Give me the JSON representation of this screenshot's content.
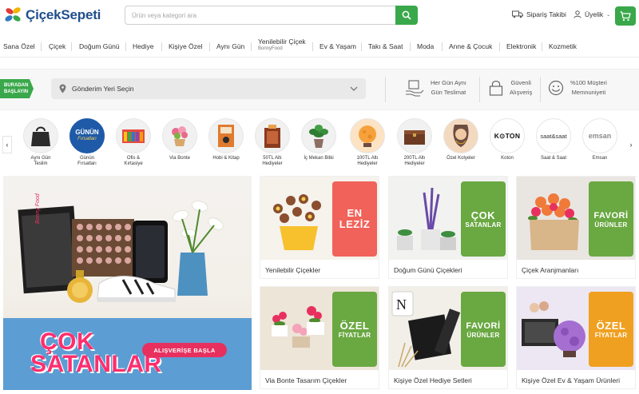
{
  "header": {
    "logo_text": "ÇiçekSepeti",
    "search_placeholder": "Ürün veya kategori ara",
    "order_tracking": "Sipariş Takibi",
    "membership": "Üyelik"
  },
  "nav": {
    "items": [
      "Sana Özel",
      "Çiçek",
      "Doğum Günü",
      "Hediye",
      "Kişiye Özel",
      "Aynı Gün",
      "Yenilebilir Çiçek",
      "Ev & Yaşam",
      "Takı & Saat",
      "Moda",
      "Anne & Çocuk",
      "Elektronik",
      "Kozmetik"
    ],
    "yenilebilir_sub": "BonnyFood"
  },
  "delivery": {
    "badge_line1": "BURADAN",
    "badge_line2": "BAŞLAYIN",
    "location_placeholder": "Gönderim Yeri Seçin",
    "features": [
      {
        "line1": "Her Gün Aynı",
        "line2": "Gün Teslimat",
        "icon": "delivery-hand-icon"
      },
      {
        "line1": "Güvenli",
        "line2": "Alışveriş",
        "icon": "lock-icon"
      },
      {
        "line1": "%100 Müşteri",
        "line2": "Memnuniyeti",
        "icon": "smile-icon"
      }
    ]
  },
  "categories": [
    {
      "line1": "Aynı Gün",
      "line2": "Teslim"
    },
    {
      "line1": "Günün",
      "line2": "Fırsatları",
      "circle_text1": "GÜNÜN",
      "circle_text2": "Fırsatları"
    },
    {
      "line1": "Ofis &",
      "line2": "Kırtasiye"
    },
    {
      "line1": "Via Bonte",
      "line2": ""
    },
    {
      "line1": "Hobi & Kitap",
      "line2": ""
    },
    {
      "line1": "50TL Altı",
      "line2": "Hediyeler"
    },
    {
      "line1": "İç Mekan Bitki",
      "line2": ""
    },
    {
      "line1": "100TL Altı",
      "line2": "Hediyeler"
    },
    {
      "line1": "200TL Altı",
      "line2": "Hediyeler"
    },
    {
      "line1": "Özel Kolyeler",
      "line2": ""
    },
    {
      "line1": "Koton",
      "line2": "",
      "circle_text1": "K⊙TON"
    },
    {
      "line1": "Saat & Saat",
      "line2": "",
      "circle_text1": "saat&saat"
    },
    {
      "line1": "Emsan",
      "line2": "",
      "circle_text1": "emsan"
    }
  ],
  "hero": {
    "title_line1": "ÇOK",
    "title_line2": "SATANLAR",
    "button": "ALIŞVERİŞE BAŞLA",
    "box_brand": "Bonny Food"
  },
  "tiles": [
    {
      "label": "Yenilebilir Çiçekler",
      "badge_big1": "EN",
      "badge_big2": "LEZİZ",
      "badge_small": "",
      "color": "#f0625a"
    },
    {
      "label": "Doğum Günü Çiçekleri",
      "badge_big1": "ÇOK",
      "badge_big2": "",
      "badge_small": "SATANLAR",
      "color": "#6aa842"
    },
    {
      "label": "Çiçek Aranjmanları",
      "badge_big1": "",
      "badge_big2": "FAVORİ",
      "badge_small": "ÜRÜNLER",
      "color": "#6aa842"
    },
    {
      "label": "Via Bonte Tasarım Çiçekler",
      "badge_big1": "ÖZEL",
      "badge_big2": "",
      "badge_small": "FİYATLAR",
      "color": "#6aa842"
    },
    {
      "label": "Kişiye Özel Hediye Setleri",
      "badge_big1": "",
      "badge_big2": "FAVORİ",
      "badge_small": "ÜRÜNLER",
      "color": "#6aa842"
    },
    {
      "label": "Kişiye Özel Ev & Yaşam Ürünleri",
      "badge_big1": "ÖZEL",
      "badge_big2": "",
      "badge_small": "FİYATLAR",
      "color": "#f0a020"
    }
  ],
  "colors": {
    "brand_green": "#3aa84a",
    "brand_blue": "#1f4e8c",
    "hero_pink": "#ff2e6e"
  }
}
